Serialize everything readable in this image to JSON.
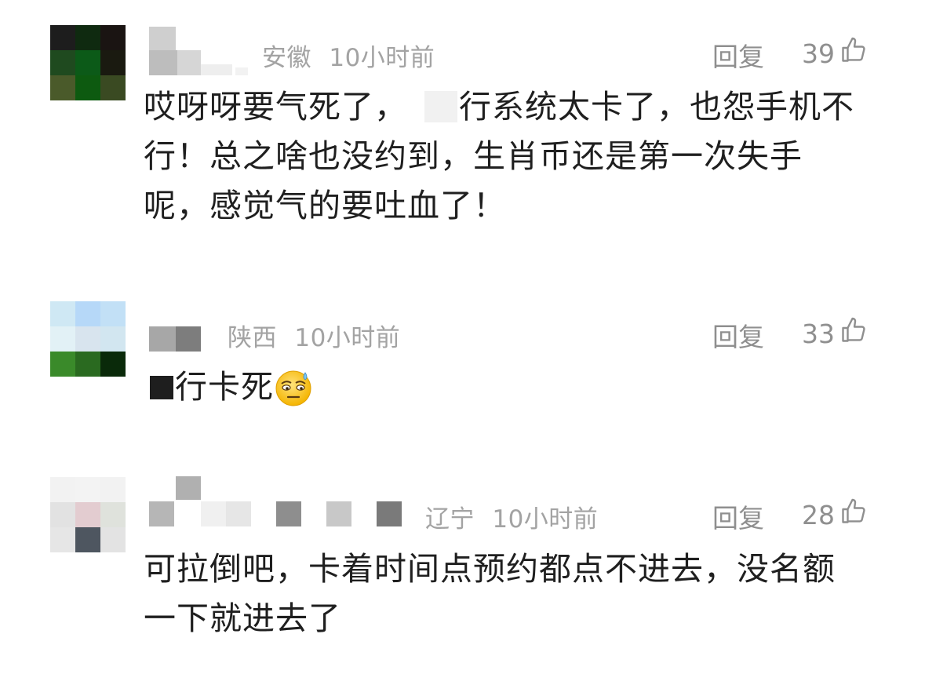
{
  "comments": [
    {
      "location": "安徽",
      "time": "10小时前",
      "reply_label": "回复",
      "likes": "39",
      "text_before_redaction": "哎呀呀要气死了，",
      "text_after_redaction": "行系统太卡了，也怨手机不行！总之啥也没约到，生肖币还是第一次失手呢，感觉气的要吐血了！",
      "avatar_colors": [
        "#1d1d1d",
        "#0f2a10",
        "#1a1412",
        "#1f4a1f",
        "#0c5a18",
        "#1a1a10",
        "#4a5a2a",
        "#0d5a10",
        "#3a4a22"
      ]
    },
    {
      "location": "陕西",
      "time": "10小时前",
      "reply_label": "回复",
      "likes": "33",
      "text_after_redaction": "行卡死",
      "emoji": "sweat-smile-emoji",
      "avatar_colors": [
        "#cfe8f4",
        "#b6d8f8",
        "#c2e0f6",
        "#e2f1f6",
        "#d8e4ee",
        "#d2e6f0",
        "#3a8a2a",
        "#2a6a20",
        "#0a2a0a"
      ]
    },
    {
      "location": "辽宁",
      "time": "10小时前",
      "reply_label": "回复",
      "likes": "28",
      "text": "可拉倒吧，卡着时间点预约都点不进去，没名额一下就进去了",
      "avatar_colors": [
        "#f2f2f2",
        "#f3f3f3",
        "#f2f2f2",
        "#e2e2e2",
        "#e3ccd0",
        "#dfe2dc",
        "#e6e6e6",
        "#4e5660",
        "#e3e3e3"
      ]
    }
  ],
  "icons": {
    "thumbs_up": "thumbs-up-icon"
  }
}
